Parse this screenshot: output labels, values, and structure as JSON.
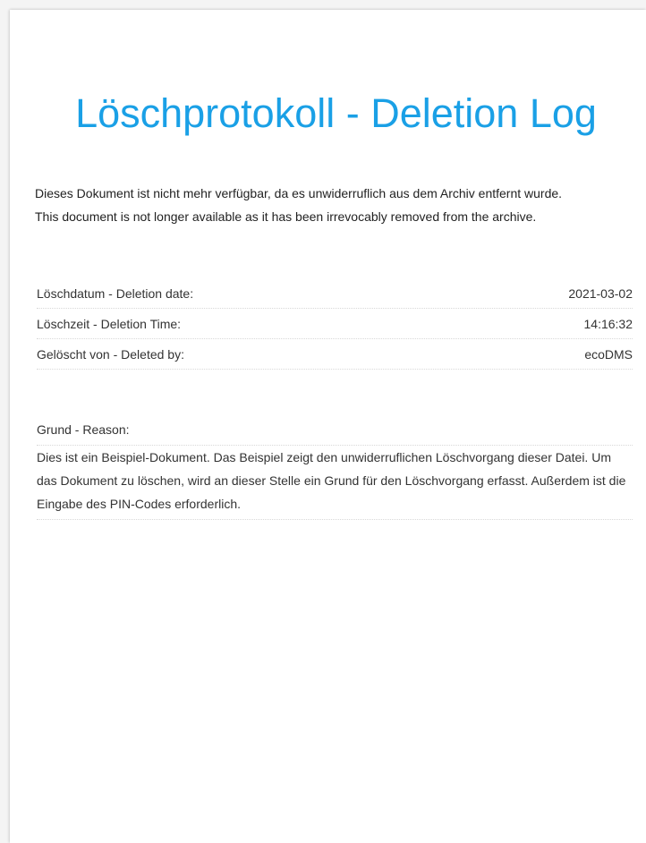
{
  "document": {
    "title": "Löschprotokoll - Deletion Log",
    "intro_de": "Dieses Dokument ist nicht mehr verfügbar, da es unwiderruflich aus dem Archiv entfernt wurde.",
    "intro_en": "This document is not longer available as it has been irrevocably removed from the archive.",
    "rows": [
      {
        "label": "Löschdatum - Deletion date:",
        "value": "2021-03-02"
      },
      {
        "label": "Löschzeit - Deletion Time:",
        "value": "14:16:32"
      },
      {
        "label": "Gelöscht von - Deleted by:",
        "value": "ecoDMS"
      }
    ],
    "reason_label": "Grund - Reason:",
    "reason_text": "Dies ist ein Beispiel-Dokument. Das Beispiel zeigt den unwiderruflichen Löschvorgang dieser Datei. Um das Dokument zu löschen, wird an dieser Stelle ein Grund für den Löschvorgang erfasst. Außerdem ist die Eingabe des PIN-Codes erforderlich."
  },
  "colors": {
    "title": "#1aa0e6",
    "text": "#333333"
  }
}
